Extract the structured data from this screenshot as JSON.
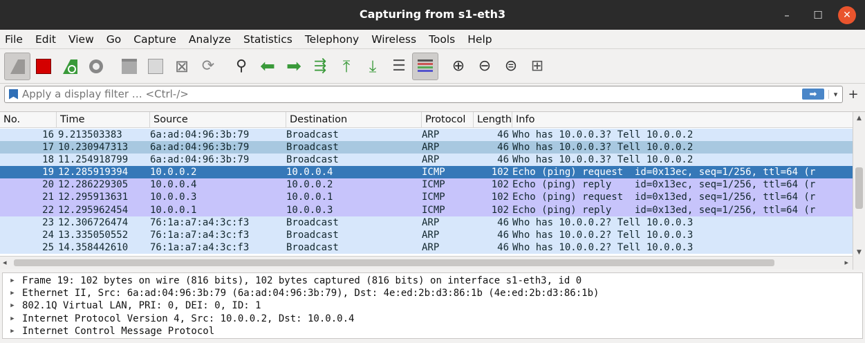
{
  "window": {
    "title": "Capturing from s1-eth3"
  },
  "menu": [
    "File",
    "Edit",
    "View",
    "Go",
    "Capture",
    "Analyze",
    "Statistics",
    "Telephony",
    "Wireless",
    "Tools",
    "Help"
  ],
  "filter": {
    "placeholder": "Apply a display filter … <Ctrl-/>"
  },
  "columns": [
    "No.",
    "Time",
    "Source",
    "Destination",
    "Protocol",
    "Length",
    "Info"
  ],
  "packets": [
    {
      "no": "16",
      "time": "9.213503383",
      "src": "6a:ad:04:96:3b:79",
      "dst": "Broadcast",
      "proto": "ARP",
      "len": "46",
      "info": "Who has 10.0.0.3? Tell 10.0.0.2"
    },
    {
      "no": "17",
      "time": "10.230947313",
      "src": "6a:ad:04:96:3b:79",
      "dst": "Broadcast",
      "proto": "ARP",
      "len": "46",
      "info": "Who has 10.0.0.3? Tell 10.0.0.2"
    },
    {
      "no": "18",
      "time": "11.254918799",
      "src": "6a:ad:04:96:3b:79",
      "dst": "Broadcast",
      "proto": "ARP",
      "len": "46",
      "info": "Who has 10.0.0.3? Tell 10.0.0.2"
    },
    {
      "no": "19",
      "time": "12.285919394",
      "src": "10.0.0.2",
      "dst": "10.0.0.4",
      "proto": "ICMP",
      "len": "102",
      "info": "Echo (ping) request  id=0x13ec, seq=1/256, ttl=64 (r"
    },
    {
      "no": "20",
      "time": "12.286229305",
      "src": "10.0.0.4",
      "dst": "10.0.0.2",
      "proto": "ICMP",
      "len": "102",
      "info": "Echo (ping) reply    id=0x13ec, seq=1/256, ttl=64 (r"
    },
    {
      "no": "21",
      "time": "12.295913631",
      "src": "10.0.0.3",
      "dst": "10.0.0.1",
      "proto": "ICMP",
      "len": "102",
      "info": "Echo (ping) request  id=0x13ed, seq=1/256, ttl=64 (r"
    },
    {
      "no": "22",
      "time": "12.295962454",
      "src": "10.0.0.1",
      "dst": "10.0.0.3",
      "proto": "ICMP",
      "len": "102",
      "info": "Echo (ping) reply    id=0x13ed, seq=1/256, ttl=64 (r"
    },
    {
      "no": "23",
      "time": "12.306726474",
      "src": "76:1a:a7:a4:3c:f3",
      "dst": "Broadcast",
      "proto": "ARP",
      "len": "46",
      "info": "Who has 10.0.0.2? Tell 10.0.0.3"
    },
    {
      "no": "24",
      "time": "13.335050552",
      "src": "76:1a:a7:a4:3c:f3",
      "dst": "Broadcast",
      "proto": "ARP",
      "len": "46",
      "info": "Who has 10.0.0.2? Tell 10.0.0.3"
    },
    {
      "no": "25",
      "time": "14.358442610",
      "src": "76:1a:a7:a4:3c:f3",
      "dst": "Broadcast",
      "proto": "ARP",
      "len": "46",
      "info": "Who has 10.0.0.2? Tell 10.0.0.3"
    }
  ],
  "details": [
    "Frame 19: 102 bytes on wire (816 bits), 102 bytes captured (816 bits) on interface s1-eth3, id 0",
    "Ethernet II, Src: 6a:ad:04:96:3b:79 (6a:ad:04:96:3b:79), Dst: 4e:ed:2b:d3:86:1b (4e:ed:2b:d3:86:1b)",
    "802.1Q Virtual LAN, PRI: 0, DEI: 0, ID: 1",
    "Internet Protocol Version 4, Src: 10.0.0.2, Dst: 10.0.0.4",
    "Internet Control Message Protocol"
  ],
  "colors": {
    "arp": "#d7e7fb",
    "arp_alt": "#a8c8e0",
    "icmp": "#c7c4fb",
    "selected": "#3678b8"
  }
}
